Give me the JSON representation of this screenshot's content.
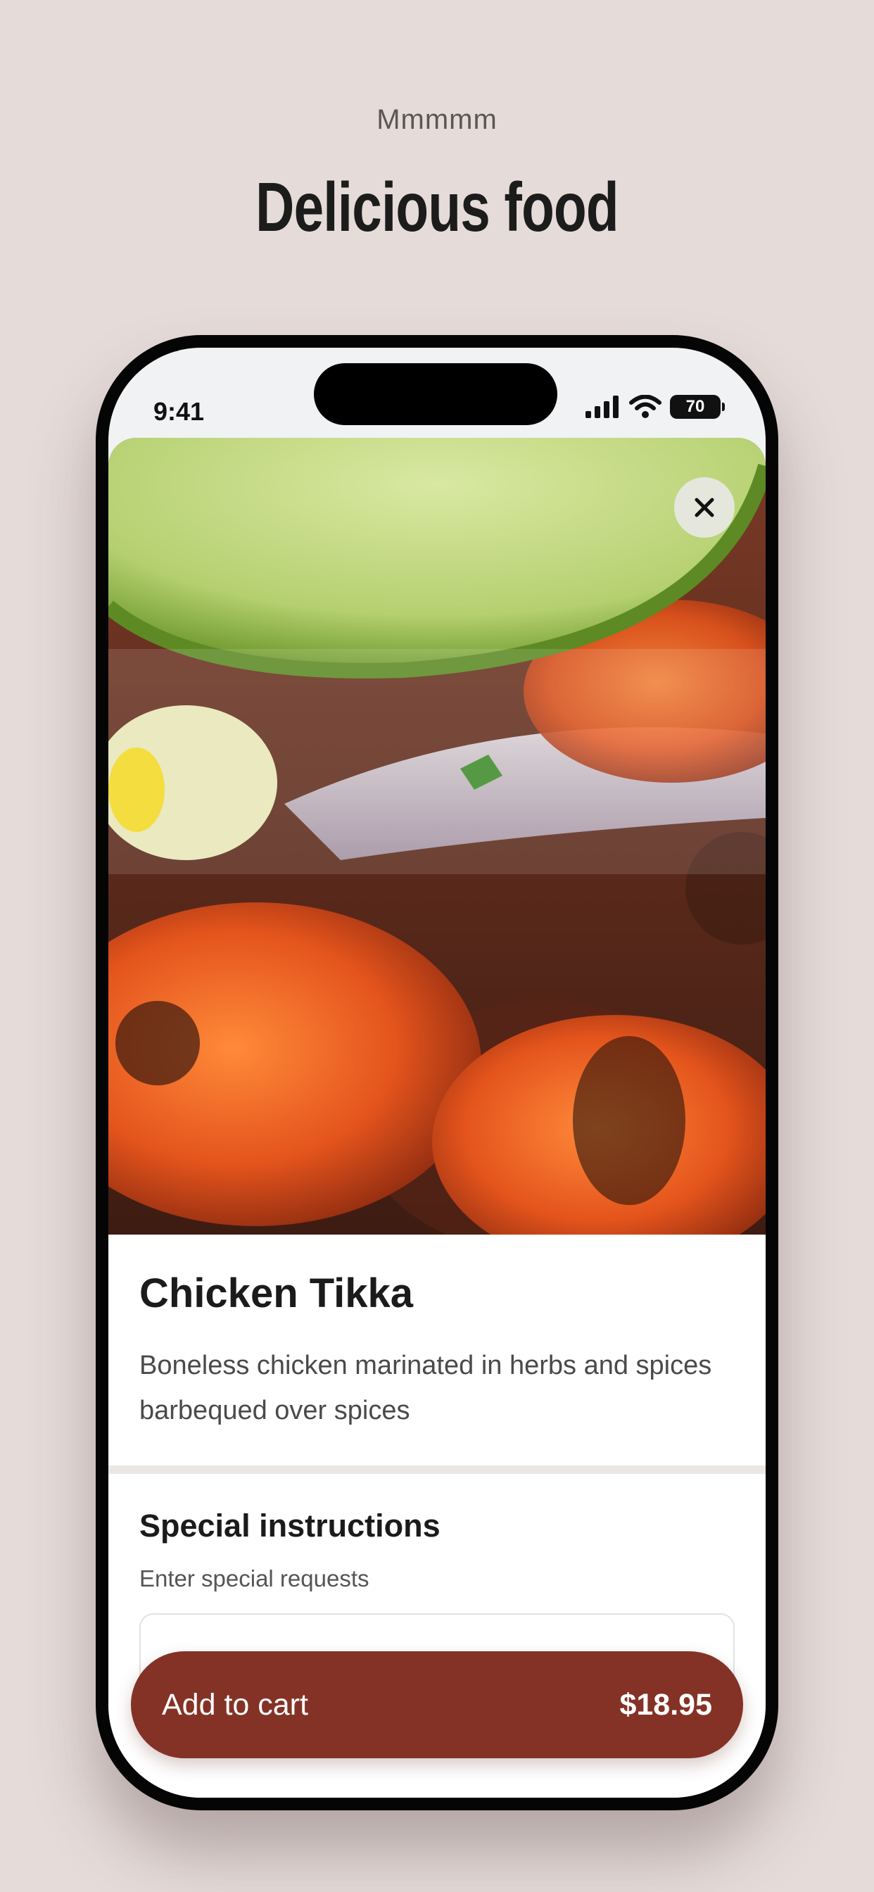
{
  "promo": {
    "eyebrow": "Mmmmm",
    "headline": "Delicious food"
  },
  "status_bar": {
    "time": "9:41",
    "battery": "70",
    "icons": [
      "signal-icon",
      "wifi-icon",
      "battery-icon"
    ]
  },
  "item": {
    "image_icon": "food-photo",
    "title": "Chicken Tikka",
    "description": "Boneless chicken marinated in herbs and spices barbequed over spices",
    "close_icon": "close-icon"
  },
  "instructions": {
    "title": "Special instructions",
    "hint": "Enter special requests",
    "value": ""
  },
  "cta": {
    "label": "Add to cart",
    "price": "$18.95"
  },
  "colors": {
    "background": "#e5dbd9",
    "accent": "#843226",
    "text": "#1b1b1b"
  }
}
